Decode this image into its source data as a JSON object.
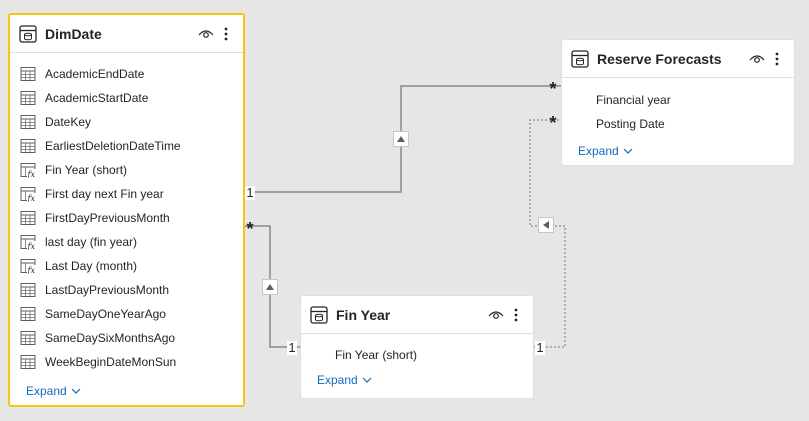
{
  "tables": {
    "dimdate": {
      "title": "DimDate",
      "fields": [
        {
          "label": "AcademicEndDate",
          "icon": "calendar-icon"
        },
        {
          "label": "AcademicStartDate",
          "icon": "calendar-icon"
        },
        {
          "label": "DateKey",
          "icon": "calendar-icon"
        },
        {
          "label": "EarliestDeletionDateTime",
          "icon": "calendar-icon"
        },
        {
          "label": "Fin Year (short)",
          "icon": "calculated-column-icon"
        },
        {
          "label": "First day next Fin year",
          "icon": "calculated-column-icon"
        },
        {
          "label": "FirstDayPreviousMonth",
          "icon": "calendar-icon"
        },
        {
          "label": "last day (fin year)",
          "icon": "calculated-column-icon"
        },
        {
          "label": "Last Day (month)",
          "icon": "calculated-column-icon"
        },
        {
          "label": "LastDayPreviousMonth",
          "icon": "calendar-icon"
        },
        {
          "label": "SameDayOneYearAgo",
          "icon": "calendar-icon"
        },
        {
          "label": "SameDaySixMonthsAgo",
          "icon": "calendar-icon"
        },
        {
          "label": "WeekBeginDateMonSun",
          "icon": "calendar-icon"
        }
      ],
      "expand_label": "Expand"
    },
    "reserve_forecasts": {
      "title": "Reserve Forecasts",
      "fields": [
        {
          "label": "Financial year"
        },
        {
          "label": "Posting Date"
        }
      ],
      "expand_label": "Expand"
    },
    "fin_year": {
      "title": "Fin Year",
      "fields": [
        {
          "label": "Fin Year (short)"
        }
      ],
      "expand_label": "Expand"
    }
  },
  "relationships": {
    "dimdate_reserve": {
      "from_card": "1",
      "to_card": "*"
    },
    "dimdate_finyear": {
      "from_card": "*",
      "to_card": "1"
    },
    "finyear_reserve": {
      "from_card": "1",
      "to_card": "*"
    }
  },
  "colors": {
    "canvas": "#e6e6e6",
    "selected_border": "#f2c811",
    "link": "#0f6cbd",
    "line": "#8a8886"
  }
}
